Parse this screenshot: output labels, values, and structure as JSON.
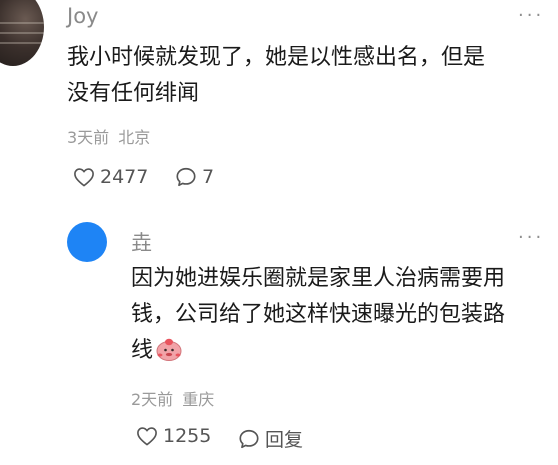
{
  "comment": {
    "username": "Joy",
    "more": "···",
    "text_line1": "我小时候就发现了，她是以性感出名，但是",
    "text_line2": "没有任何绯闻",
    "time": "3天前",
    "location": "北京",
    "likes": "2477",
    "replies": "7"
  },
  "reply": {
    "username": "垚",
    "more": "···",
    "text_line1": "因为她进娱乐圈就是家里人治病需要用",
    "text_line2": "钱，公司给了她这样快速曝光的包装路",
    "text_line3": "线",
    "time": "2天前",
    "location": "重庆",
    "likes": "1255",
    "reply_label": "回复"
  },
  "colors": {
    "reply_avatar": "#1e84f5",
    "meta_text": "#9a9a9a",
    "username": "#8a8a8a"
  }
}
